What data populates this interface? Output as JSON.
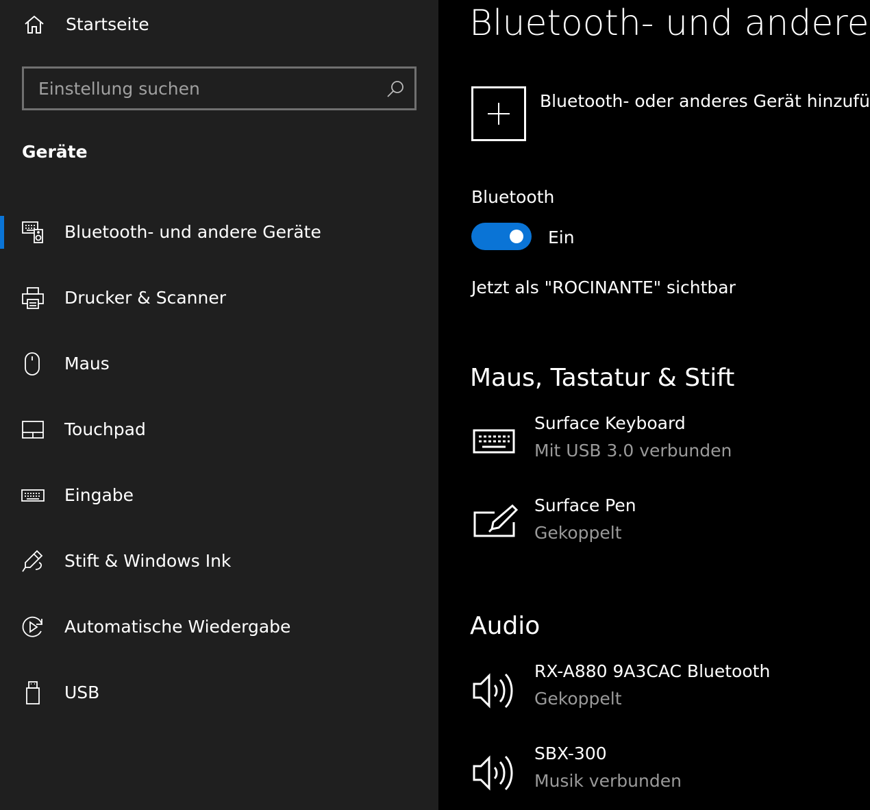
{
  "sidebar": {
    "home_label": "Startseite",
    "search_placeholder": "Einstellung suchen",
    "section_title": "Geräte",
    "items": [
      {
        "label": "Bluetooth- und andere Geräte",
        "icon": "bluetooth-devices-icon",
        "active": true
      },
      {
        "label": "Drucker & Scanner",
        "icon": "printer-icon"
      },
      {
        "label": "Maus",
        "icon": "mouse-icon"
      },
      {
        "label": "Touchpad",
        "icon": "touchpad-icon"
      },
      {
        "label": "Eingabe",
        "icon": "keyboard-icon"
      },
      {
        "label": "Stift & Windows Ink",
        "icon": "pen-icon"
      },
      {
        "label": "Automatische Wiedergabe",
        "icon": "autoplay-icon"
      },
      {
        "label": "USB",
        "icon": "usb-icon"
      }
    ]
  },
  "main": {
    "title": "Bluetooth- und andere Geräte",
    "add_device_label": "Bluetooth- oder anderes Gerät hinzufügen",
    "bluetooth_label": "Bluetooth",
    "bluetooth_state": "Ein",
    "bluetooth_on": true,
    "visible_as": "Jetzt als \"ROCINANTE\" sichtbar",
    "groups": [
      {
        "title": "Maus, Tastatur & Stift",
        "devices": [
          {
            "name": "Surface Keyboard",
            "status": "Mit USB 3.0 verbunden",
            "icon": "keyboard-icon"
          },
          {
            "name": "Surface Pen",
            "status": "Gekoppelt",
            "icon": "pen-tablet-icon"
          }
        ]
      },
      {
        "title": "Audio",
        "devices": [
          {
            "name": "RX-A880 9A3CAC Bluetooth",
            "status": "Gekoppelt",
            "icon": "speaker-icon"
          },
          {
            "name": "SBX-300",
            "status": "Musik verbunden",
            "icon": "speaker-icon"
          }
        ]
      }
    ]
  },
  "colors": {
    "accent": "#0a74d6",
    "sidebar_bg": "#1f1f1f",
    "main_bg": "#000000",
    "secondary_text": "#9a9a9a"
  }
}
